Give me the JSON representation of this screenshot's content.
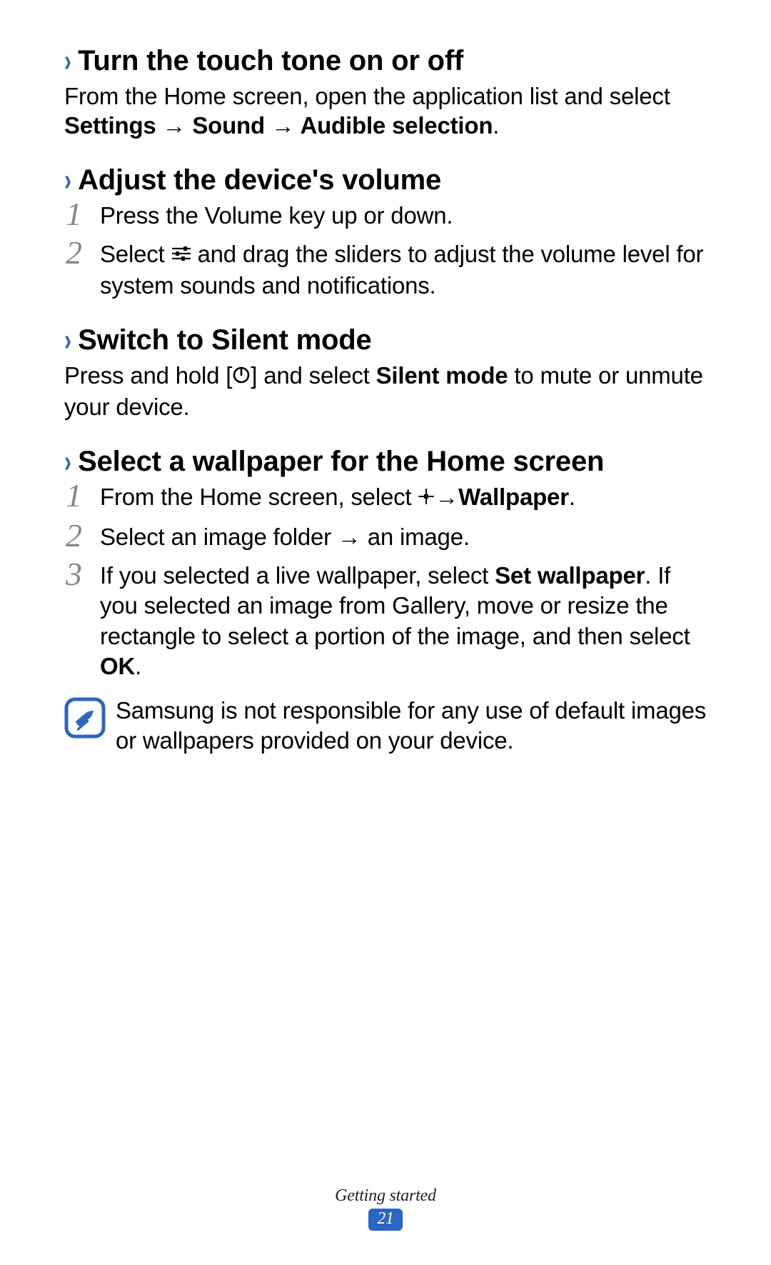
{
  "sections": {
    "s1": {
      "heading": "Turn the touch tone on or off",
      "body_pre": "From the Home screen, open the application list and select ",
      "body_bold": "Settings → Sound → Audible selection",
      "body_post": "."
    },
    "s2": {
      "heading": "Adjust the device's volume",
      "step1": "Press the Volume key up or down.",
      "step2_pre": "Select ",
      "step2_post": " and drag the sliders to adjust the volume level for system sounds and notifications."
    },
    "s3": {
      "heading": "Switch to Silent mode",
      "body_pre": "Press and hold [",
      "body_mid": "] and select ",
      "body_bold": "Silent mode",
      "body_post": " to mute or unmute your device."
    },
    "s4": {
      "heading": "Select a wallpaper for the Home screen",
      "step1_pre": "From the Home screen, select ",
      "step1_arrow": " → ",
      "step1_bold": "Wallpaper",
      "step1_post": ".",
      "step2": "Select an image folder → an image.",
      "step3_pre": "If you selected a live wallpaper, select ",
      "step3_bold": "Set wallpaper",
      "step3_mid": ". If you selected an image from Gallery, move or resize the rectangle to select a portion of the image, and then select ",
      "step3_bold2": "OK",
      "step3_post": ".",
      "note": "Samsung is not responsible for any use of default images or wallpapers provided on your device."
    }
  },
  "footer": {
    "section_name": "Getting started",
    "page_number": "21"
  },
  "icons": {
    "sliders": "sliders-icon",
    "power": "power-icon",
    "plus": "plus-icon",
    "note": "note-pencil-icon"
  }
}
